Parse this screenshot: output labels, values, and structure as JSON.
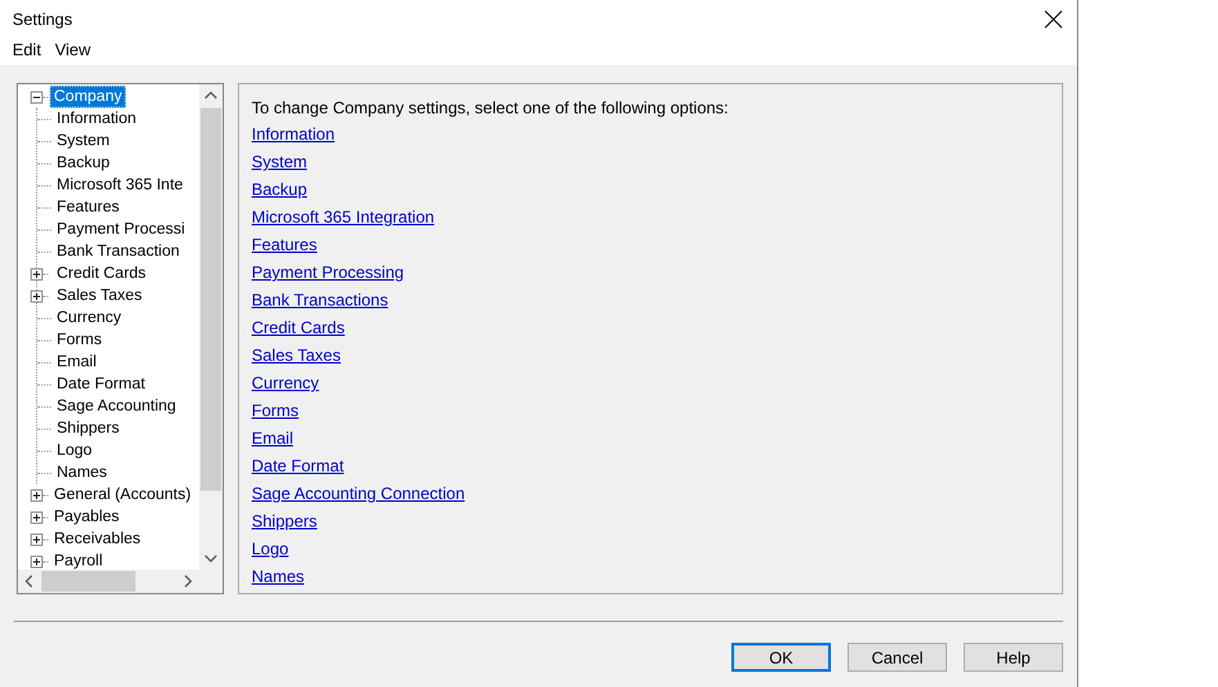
{
  "window": {
    "title": "Settings"
  },
  "menu": [
    "Edit",
    "View"
  ],
  "tree": {
    "nodes": [
      {
        "label": "Company",
        "kind": "branch",
        "expanded": true,
        "selected": true,
        "children": [
          {
            "label": "Information",
            "kind": "leaf",
            "selected": false
          },
          {
            "label": "System",
            "kind": "leaf",
            "selected": false
          },
          {
            "label": "Backup",
            "kind": "leaf",
            "selected": false
          },
          {
            "label": "Microsoft 365 Inte",
            "kind": "leaf",
            "selected": false
          },
          {
            "label": "Features",
            "kind": "leaf",
            "selected": false
          },
          {
            "label": "Payment Processi",
            "kind": "leaf",
            "selected": false
          },
          {
            "label": "Bank Transaction",
            "kind": "leaf",
            "selected": false
          },
          {
            "label": "Credit Cards",
            "kind": "branch",
            "expanded": false,
            "selected": false
          },
          {
            "label": "Sales Taxes",
            "kind": "branch",
            "expanded": false,
            "selected": false
          },
          {
            "label": "Currency",
            "kind": "leaf",
            "selected": false
          },
          {
            "label": "Forms",
            "kind": "leaf",
            "selected": false
          },
          {
            "label": "Email",
            "kind": "leaf",
            "selected": false
          },
          {
            "label": "Date Format",
            "kind": "leaf",
            "selected": false
          },
          {
            "label": "Sage Accounting",
            "kind": "leaf",
            "selected": false
          },
          {
            "label": "Shippers",
            "kind": "leaf",
            "selected": false
          },
          {
            "label": "Logo",
            "kind": "leaf",
            "selected": false
          },
          {
            "label": "Names",
            "kind": "leaf",
            "selected": false
          }
        ]
      },
      {
        "label": "General (Accounts)",
        "kind": "branch",
        "expanded": false,
        "selected": false
      },
      {
        "label": "Payables",
        "kind": "branch",
        "expanded": false,
        "selected": false
      },
      {
        "label": "Receivables",
        "kind": "branch",
        "expanded": false,
        "selected": false
      },
      {
        "label": "Payroll",
        "kind": "branch",
        "expanded": false,
        "selected": false
      }
    ]
  },
  "content": {
    "intro": "To change Company settings, select one of the following options:",
    "links": [
      "Information",
      "System",
      "Backup",
      "Microsoft 365 Integration",
      "Features",
      "Payment Processing",
      "Bank Transactions",
      "Credit Cards",
      "Sales Taxes",
      "Currency",
      "Forms",
      "Email",
      "Date Format",
      "Sage Accounting Connection",
      "Shippers",
      "Logo",
      "Names"
    ]
  },
  "buttons": [
    {
      "label": "OK",
      "default": true
    },
    {
      "label": "Cancel",
      "default": false
    },
    {
      "label": "Help",
      "default": false
    }
  ]
}
